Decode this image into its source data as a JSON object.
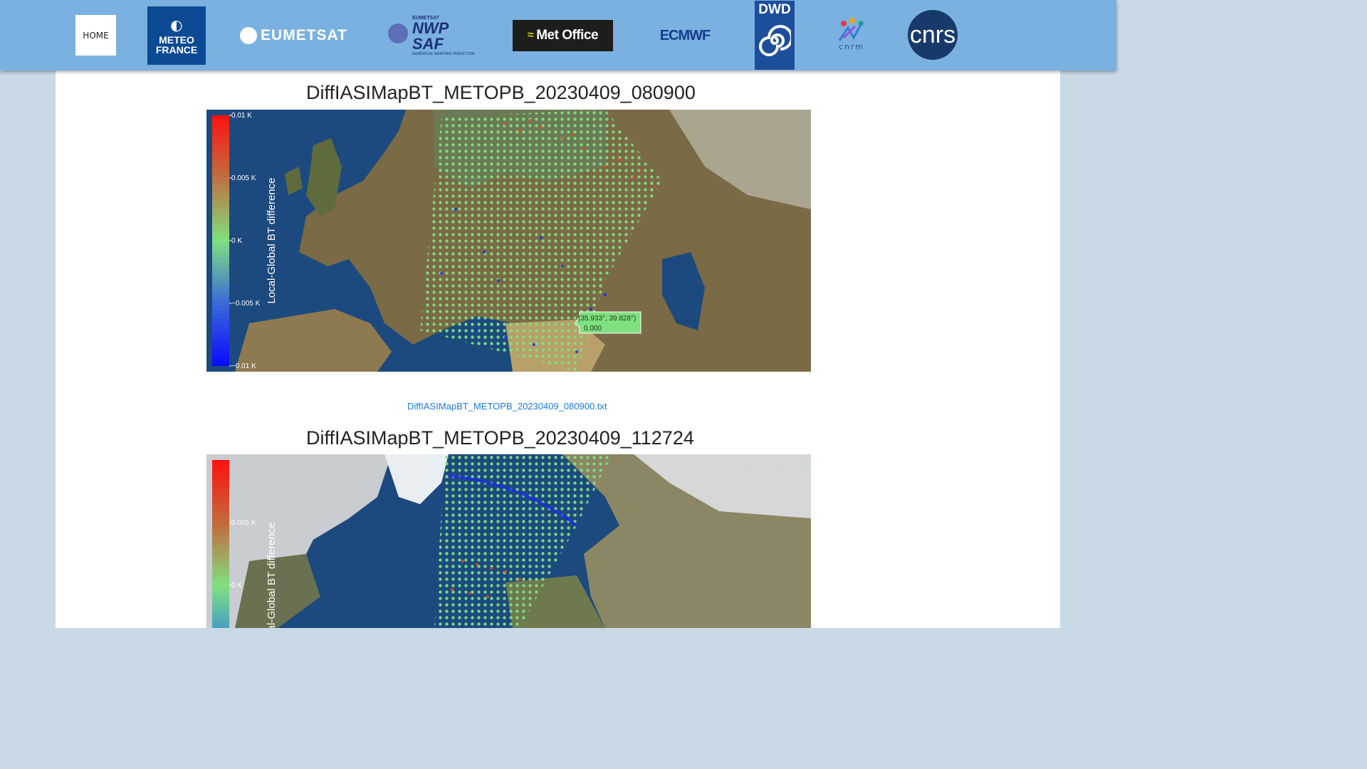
{
  "nav": {
    "home_label": "HOME",
    "logos": {
      "meteo_france": "METEO FRANCE",
      "eumetsat": "EUMETSAT",
      "nwp_small": "EUMETSAT",
      "nwp_saf": "NWP SAF",
      "nwp_sub": "NUMERICAL WEATHER PREDICTION",
      "met_office": "Met Office",
      "ecmwf": "ECMWF",
      "dwd": "DWD",
      "cnrm": "cnrm",
      "cnrs": "cnrs"
    }
  },
  "plots": [
    {
      "title": "DiffIASIMapBT_METOPB_20230409_080900",
      "colorbar": {
        "label": "Local-Global BT difference",
        "ticks": [
          "0.01 K",
          "0.005 K",
          "0 K",
          "−0.005 K",
          "−0.01 K"
        ]
      },
      "tooltip": {
        "coords": "(35.933°, 39.828°)",
        "value": "0.000"
      },
      "link": "DiffIASIMapBT_METOPB_20230409_080900.txt"
    },
    {
      "title": "DiffIASIMapBT_METOPB_20230409_112724",
      "colorbar": {
        "label": "Local-Global BT difference",
        "ticks": [
          "0.005 K",
          "0 K"
        ]
      }
    }
  ],
  "colors": {
    "topbar": "#7ab1e0",
    "ocean": "#1d4a7e",
    "land": "#7a6a45",
    "scale_high": "#ff1a1a",
    "scale_mid": "#7fe07f",
    "scale_low": "#1a1aff",
    "link": "#1a7ad8"
  }
}
